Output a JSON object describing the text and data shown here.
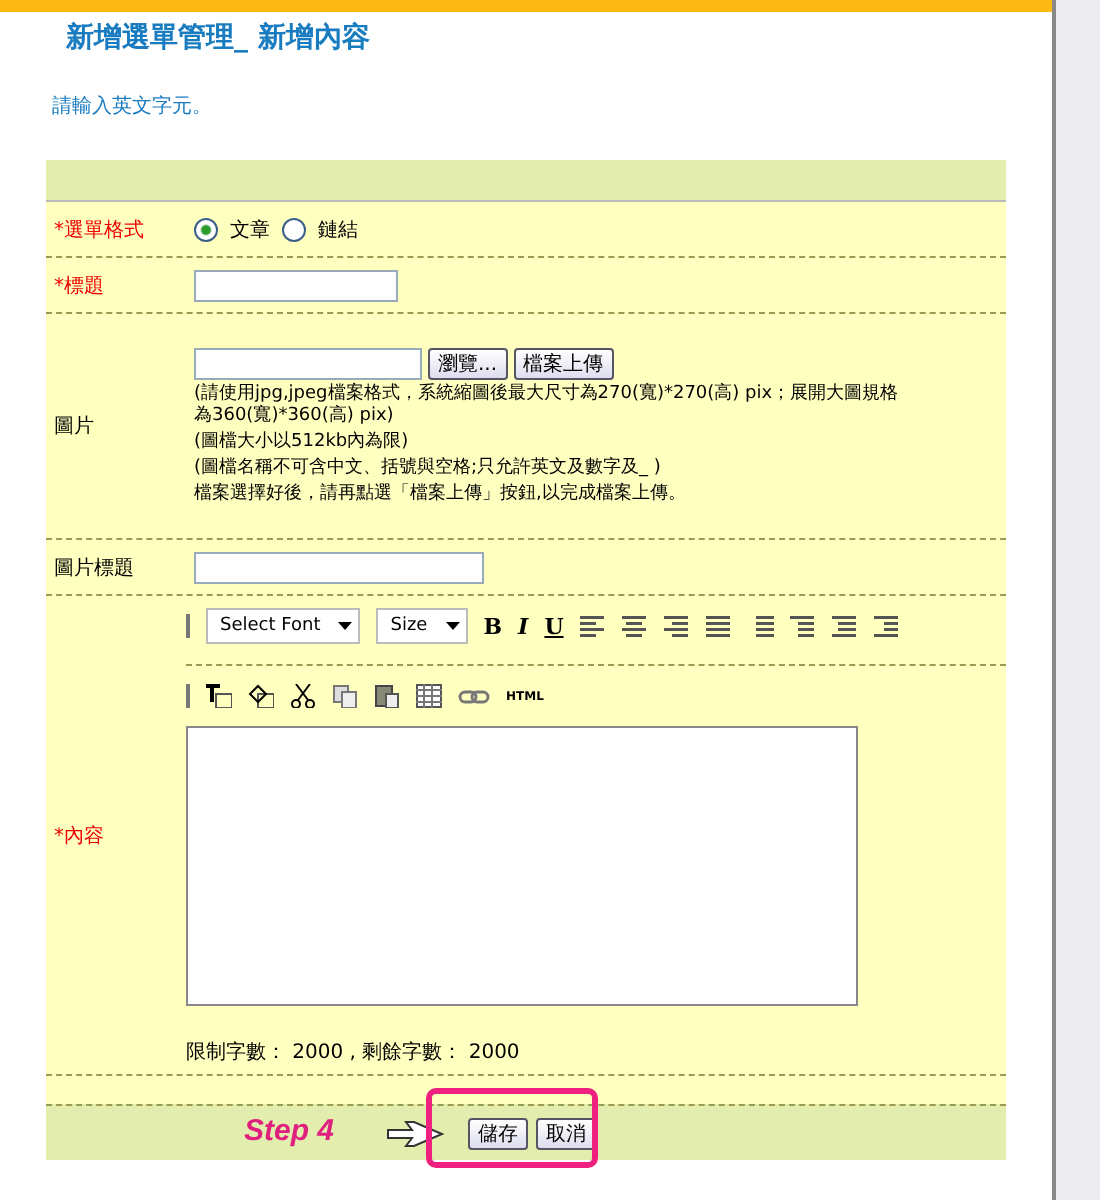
{
  "title": "新增選單管理_ 新增內容",
  "hint": "請輸入英文字元。",
  "rows": [
    {
      "kind": "radio",
      "label": "*選單格式",
      "required": true,
      "options": [
        {
          "label": "文章",
          "selected": true
        },
        {
          "label": "鏈結",
          "selected": false
        }
      ]
    },
    {
      "kind": "short-text",
      "label": "*標題",
      "required": true
    },
    {
      "kind": "upload",
      "label": "圖片",
      "required": false,
      "buttons": [
        "瀏覽...",
        "檔案上傳"
      ],
      "notes": [
        "(請使用jpg,jpeg檔案格式，系統縮圖後最大尺寸為270(寬)*270(高) pix；展開大圖規格為360(寬)*360(高) pix)",
        "(圖檔大小以512kb內為限)",
        "(圖檔名稱不可含中文、括號與空格;只允許英文及數字及_ )",
        "檔案選擇好後，請再點選「檔案上傳」按鈕,以完成檔案上傳。"
      ]
    },
    {
      "kind": "text",
      "label": "圖片標題",
      "required": false
    },
    {
      "kind": "editor",
      "label": "*內容",
      "required": true,
      "font_select": "Select Font",
      "size_select": "Size",
      "format_buttons": [
        "B",
        "I",
        "U"
      ],
      "html_button": "HTML",
      "counter": "限制字數： 2000 , 剩餘字數： 2000"
    }
  ],
  "footer": {
    "step": "Step 4",
    "buttons": [
      "儲存",
      "取消"
    ]
  }
}
